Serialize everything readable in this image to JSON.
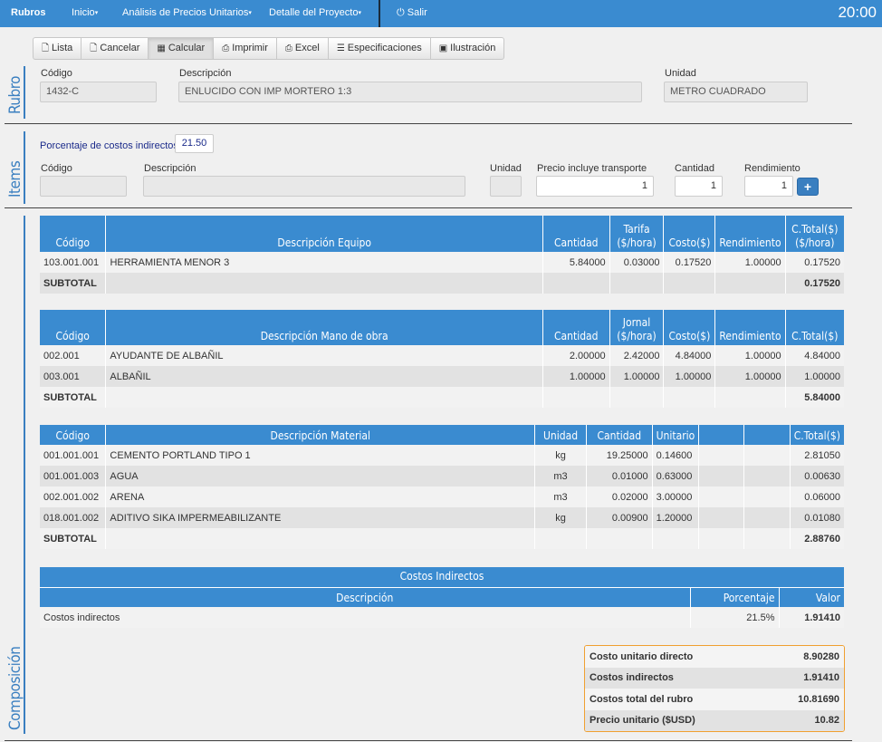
{
  "nav": {
    "brand": "Rubros",
    "items": [
      "Inicio",
      "Análisis de Precios Unitarios",
      "Detalle del Proyecto"
    ],
    "logout": "Salir",
    "clock": "20:00"
  },
  "toolbar": [
    "Lista",
    "Cancelar",
    "Calcular",
    "Imprimir",
    "Excel",
    "Especificaciones",
    "Ilustración"
  ],
  "rubro": {
    "section_label": "Rubro",
    "codigo_label": "Código",
    "codigo": "1432-C",
    "descripcion_label": "Descripción",
    "descripcion": "ENLUCIDO CON IMP MORTERO 1:3",
    "unidad_label": "Unidad",
    "unidad": "METRO CUADRADO"
  },
  "items": {
    "section_label": "Items",
    "porcentaje_label": "Porcentaje de costos indirectos",
    "porcentaje": "21.50",
    "codigo_label": "Código",
    "descripcion_label": "Descripción",
    "unidad_label": "Unidad",
    "transporte_label": "Precio incluye transporte",
    "cantidad_label": "Cantidad",
    "rendimiento_label": "Rendimiento",
    "transporte": "1",
    "cantidad": "1",
    "rendimiento": "1",
    "add": "+"
  },
  "composicion_label": "Composición",
  "equipo": {
    "headers": [
      "Código",
      "Descripción Equipo",
      "Cantidad",
      "Tarifa\n($/hora)",
      "Costo($)",
      "Rendimiento",
      "C.Total($)\n($/hora)"
    ],
    "rows": [
      [
        "103.001.001",
        "HERRAMIENTA MENOR 3",
        "5.84000",
        "0.03000",
        "0.17520",
        "1.00000",
        "0.17520"
      ]
    ],
    "subtotal_label": "SUBTOTAL",
    "subtotal": "0.17520"
  },
  "mano_obra": {
    "headers": [
      "Código",
      "Descripción Mano de obra",
      "Cantidad",
      "Jornal\n($/hora)",
      "Costo($)",
      "Rendimiento",
      "C.Total($)"
    ],
    "rows": [
      [
        "002.001",
        "AYUDANTE DE ALBAÑIL",
        "2.00000",
        "2.42000",
        "4.84000",
        "1.00000",
        "4.84000"
      ],
      [
        "003.001",
        "ALBAÑIL",
        "1.00000",
        "1.00000",
        "1.00000",
        "1.00000",
        "1.00000"
      ]
    ],
    "subtotal_label": "SUBTOTAL",
    "subtotal": "5.84000"
  },
  "material": {
    "headers": [
      "Código",
      "Descripción Material",
      "Unidad",
      "Cantidad",
      "Unitario",
      "",
      "",
      "C.Total($)"
    ],
    "rows": [
      [
        "001.001.001",
        "CEMENTO PORTLAND TIPO 1",
        "kg",
        "19.25000",
        "0.14600",
        "",
        "",
        "2.81050"
      ],
      [
        "001.001.003",
        "AGUA",
        "m3",
        "0.01000",
        "0.63000",
        "",
        "",
        "0.00630"
      ],
      [
        "002.001.002",
        "ARENA",
        "m3",
        "0.02000",
        "3.00000",
        "",
        "",
        "0.06000"
      ],
      [
        "018.001.002",
        "ADITIVO SIKA IMPERMEABILIZANTE",
        "kg",
        "0.00900",
        "1.20000",
        "",
        "",
        "0.01080"
      ]
    ],
    "subtotal_label": "SUBTOTAL",
    "subtotal": "2.88760"
  },
  "indirectos": {
    "title": "Costos Indirectos",
    "headers": [
      "Descripción",
      "Porcentaje",
      "Valor"
    ],
    "rows": [
      [
        "Costos indirectos",
        "21.5%",
        "1.91410"
      ]
    ]
  },
  "summary": [
    {
      "label": "Costo unitario directo",
      "value": "8.90280"
    },
    {
      "label": "Costos indirectos",
      "value": "1.91410"
    },
    {
      "label": "Costos total del rubro",
      "value": "10.81690"
    },
    {
      "label": "Precio unitario ($USD)",
      "value": "10.82"
    }
  ],
  "colors": {
    "primary": "#3a8bd0",
    "accent_border": "#f0a030"
  }
}
